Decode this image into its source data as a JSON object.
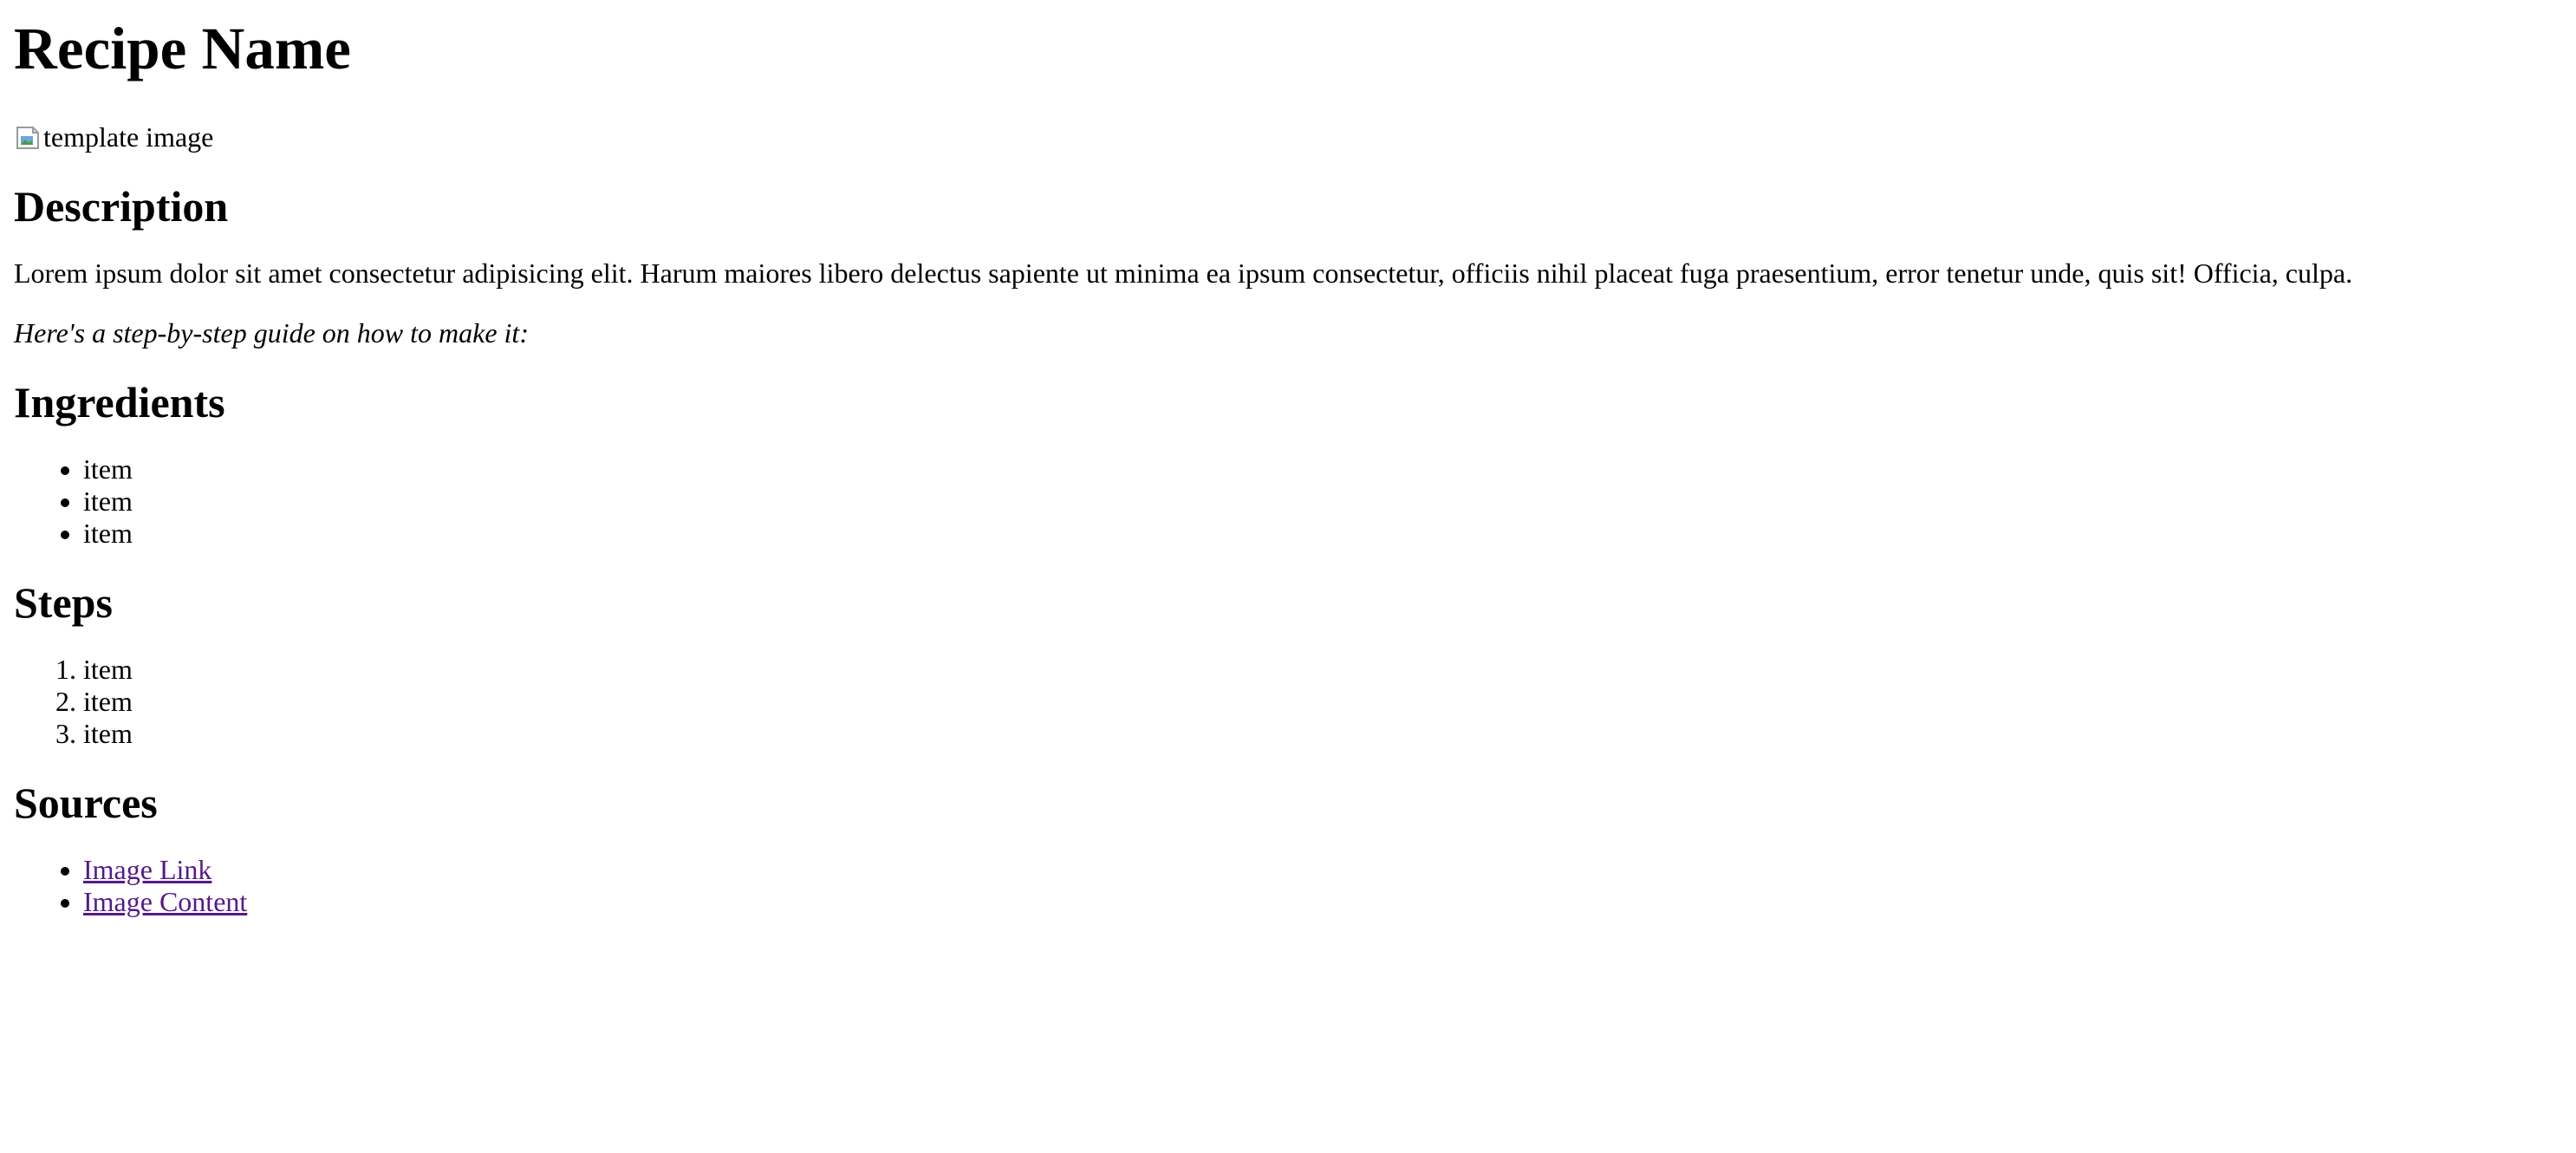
{
  "recipe": {
    "title": "Recipe Name",
    "image_alt": "template image",
    "description_heading": "Description",
    "description_text": "Lorem ipsum dolor sit amet consectetur adipisicing elit. Harum maiores libero delectus sapiente ut minima ea ipsum consectetur, officiis nihil placeat fuga praesentium, error tenetur unde, quis sit! Officia, culpa.",
    "guide_text": "Here's a step-by-step guide on how to make it:",
    "ingredients_heading": "Ingredients",
    "ingredients": [
      "item",
      "item",
      "item"
    ],
    "steps_heading": "Steps",
    "steps": [
      "item",
      "item",
      "item"
    ],
    "sources_heading": "Sources",
    "sources": [
      "Image Link",
      "Image Content"
    ]
  },
  "colors": {
    "text": "#000000",
    "visited_link": "#551a8b",
    "background": "#ffffff"
  },
  "icons": {
    "broken_image": "broken-image-icon"
  }
}
